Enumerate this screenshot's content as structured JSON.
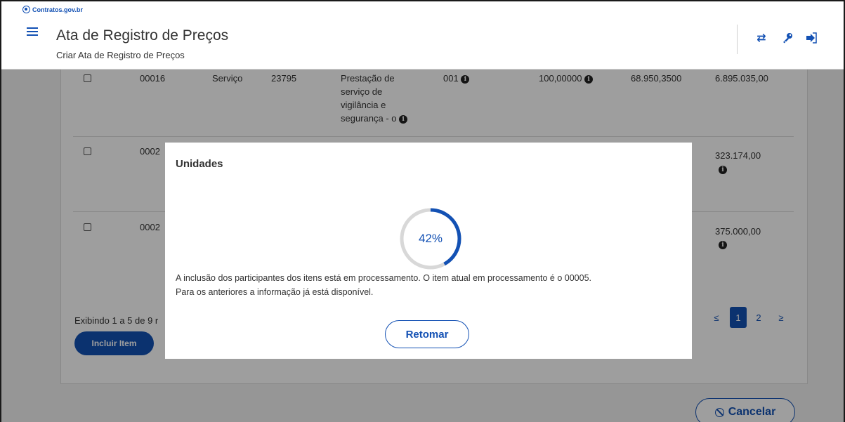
{
  "header": {
    "brand": "Contratos.gov.br",
    "title": "Ata de Registro de Preços",
    "subtitle": "Criar Ata de Registro de Preços",
    "icons": [
      "menu-icon",
      "swap-icon",
      "key-icon",
      "logout-icon"
    ]
  },
  "table": {
    "rows": [
      {
        "checked": false,
        "numero": "00016",
        "tipo": "Serviço",
        "codigo": "23795",
        "descricao": [
          "Prestação de",
          "serviço de",
          "vigilância e",
          "segurança - o"
        ],
        "unidade": "001",
        "quantidade": "100,00000",
        "valor_unitario": "68.950,3500",
        "valor_total": "6.895.035,00"
      },
      {
        "checked": false,
        "numero_partial": "0002",
        "valor_total": "323.174,00"
      },
      {
        "checked": false,
        "numero_partial": "0002",
        "valor_total": "375.000,00"
      }
    ],
    "footer_text": "Exibindo 1 a 5 de 9 r",
    "include_button": "Incluir Item",
    "pagination": {
      "prev": "≤",
      "pages": [
        "1",
        "2"
      ],
      "active_page": "1",
      "next": "≥"
    }
  },
  "cancel_button": "Cancelar",
  "modal": {
    "title": "Unidades",
    "progress_percent": 42,
    "progress_label": "42%",
    "message_line1": "A inclusão dos participantes dos itens está em processamento. O item atual em processamento é o 00005.",
    "message_line2": "Para os anteriores a informação já está disponível.",
    "button": "Retomar"
  },
  "colors": {
    "primary": "#1351b4",
    "overlay": "rgba(0,0,0,0.38)"
  }
}
